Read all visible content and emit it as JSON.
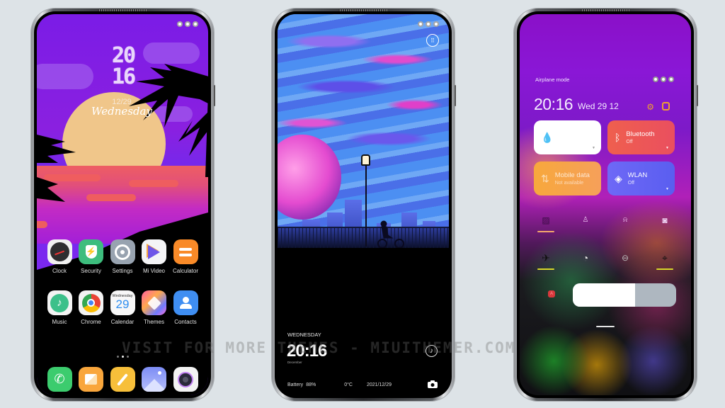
{
  "watermark": "VISIT FOR MORE THEMES - MIUITHEMER.COM",
  "colors": {
    "background": "#dde3e7",
    "phone1_sky": "#7b1ce6",
    "phone1_sun": "#f0c68a",
    "phone3_bluetooth_tile": "#ee5a52",
    "phone3_mobile_tile": "#f6a23c",
    "phone3_wlan_tile": "#6b63f4",
    "accent_underline": "#f3a86c",
    "accent_yellow": "#d8d82a"
  },
  "phone1": {
    "name": "home-screen",
    "clock_hour": "20",
    "clock_minute": "16",
    "date": "12/29",
    "weekday": "Wednesday",
    "apps_row1": [
      {
        "label": "Clock",
        "icon": "clock-icon"
      },
      {
        "label": "Security",
        "icon": "shield-bolt-icon"
      },
      {
        "label": "Settings",
        "icon": "gear-icon"
      },
      {
        "label": "Mi Video",
        "icon": "play-icon"
      },
      {
        "label": "Calculator",
        "icon": "equals-icon"
      }
    ],
    "apps_row2": [
      {
        "label": "Music",
        "icon": "music-note-icon"
      },
      {
        "label": "Chrome",
        "icon": "chrome-icon"
      },
      {
        "label": "Calendar",
        "icon": "calendar-icon",
        "calendar_weekday": "Wednesday",
        "calendar_day": "29"
      },
      {
        "label": "Themes",
        "icon": "brush-icon"
      },
      {
        "label": "Contacts",
        "icon": "person-icon"
      }
    ],
    "page_dots": 3,
    "active_page": 2,
    "dock": [
      {
        "icon": "phone-icon"
      },
      {
        "icon": "message-icon"
      },
      {
        "icon": "notes-pencil-icon"
      },
      {
        "icon": "gallery-icon"
      },
      {
        "icon": "camera-lens-icon"
      }
    ]
  },
  "phone2": {
    "name": "lock-screen",
    "weekday": "WEDNESDAY",
    "time": "20:16",
    "month": "December",
    "battery_label": "Battery",
    "battery_value": "88%",
    "temperature": "0°C",
    "date": "2021/12/29",
    "music_icon": "♪",
    "camera_icon": "camera-icon",
    "grid_icon": "⠿"
  },
  "phone3": {
    "name": "control-center",
    "airplane_label": "Airplane mode",
    "time": "20:16",
    "date": "Wed 29 12",
    "tiles": [
      {
        "label": "",
        "sub": "",
        "icon": "water-drop-icon",
        "glyph": "💧"
      },
      {
        "label": "Bluetooth",
        "sub": "Off",
        "icon": "bluetooth-icon",
        "glyph": "ᛒ"
      },
      {
        "label": "Mobile data",
        "sub": "Not available",
        "icon": "mobile-data-icon",
        "glyph": "⇅"
      },
      {
        "label": "WLAN",
        "sub": "Off",
        "icon": "wifi-icon",
        "glyph": "◈"
      }
    ],
    "toggles_row1": [
      {
        "icon": "no-disturb-icon",
        "glyph": "▨",
        "active": true
      },
      {
        "icon": "flashlight-icon",
        "glyph": "♙",
        "active": false
      },
      {
        "icon": "bell-icon",
        "glyph": "🔔",
        "active": false
      },
      {
        "icon": "screenshot-icon",
        "glyph": "◙",
        "active": false
      }
    ],
    "toggles_row2": [
      {
        "icon": "airplane-icon",
        "glyph": "✈",
        "active": true
      },
      {
        "icon": "timer-icon",
        "glyph": "◔",
        "active": false
      },
      {
        "icon": "lock-rotation-icon",
        "glyph": "⊖",
        "active": false
      },
      {
        "icon": "location-icon",
        "glyph": "⌖",
        "active": true
      }
    ],
    "auto_brightness_label": "A",
    "brightness_level": 0.6
  }
}
